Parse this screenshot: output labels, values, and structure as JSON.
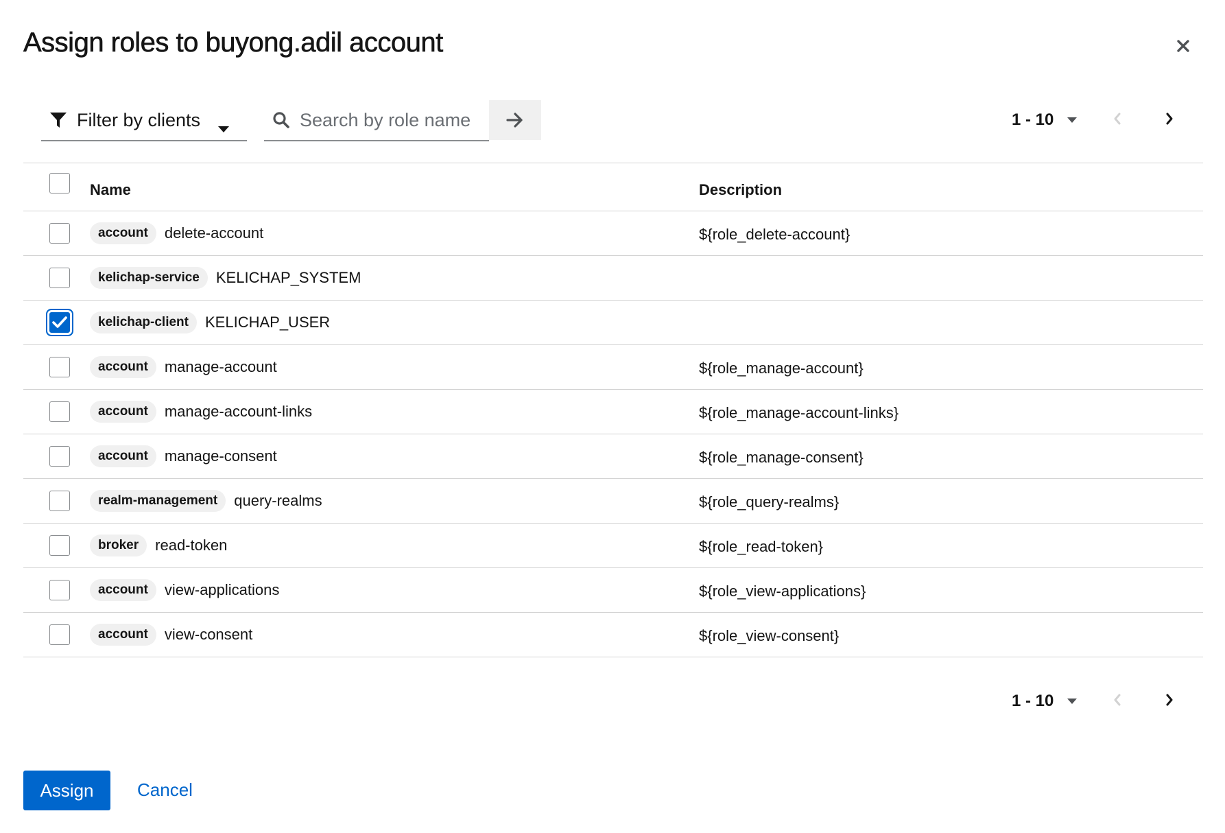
{
  "modal": {
    "title": "Assign roles to buyong.adil account"
  },
  "toolbar": {
    "filter_label": "Filter by clients",
    "search_placeholder": "Search by role name",
    "pagination_range": "1 - 10"
  },
  "table": {
    "headers": {
      "name": "Name",
      "description": "Description"
    },
    "rows": [
      {
        "client": "account",
        "role": "delete-account",
        "description": "${role_delete-account}",
        "checked": false
      },
      {
        "client": "kelichap-service",
        "role": "KELICHAP_SYSTEM",
        "description": "",
        "checked": false
      },
      {
        "client": "kelichap-client",
        "role": "KELICHAP_USER",
        "description": "",
        "checked": true
      },
      {
        "client": "account",
        "role": "manage-account",
        "description": "${role_manage-account}",
        "checked": false
      },
      {
        "client": "account",
        "role": "manage-account-links",
        "description": "${role_manage-account-links}",
        "checked": false
      },
      {
        "client": "account",
        "role": "manage-consent",
        "description": "${role_manage-consent}",
        "checked": false
      },
      {
        "client": "realm-management",
        "role": "query-realms",
        "description": "${role_query-realms}",
        "checked": false
      },
      {
        "client": "broker",
        "role": "read-token",
        "description": "${role_read-token}",
        "checked": false
      },
      {
        "client": "account",
        "role": "view-applications",
        "description": "${role_view-applications}",
        "checked": false
      },
      {
        "client": "account",
        "role": "view-consent",
        "description": "${role_view-consent}",
        "checked": false
      }
    ]
  },
  "footer_pagination": {
    "range": "1 - 10"
  },
  "actions": {
    "assign_label": "Assign",
    "cancel_label": "Cancel"
  },
  "colors": {
    "primary": "#0066cc",
    "badge_bg": "#f0f0f0",
    "border": "#d2d2d2"
  },
  "icons": [
    "close-icon",
    "filter-icon",
    "caret-down-icon",
    "search-icon",
    "arrow-right-icon",
    "chevron-left-icon",
    "chevron-right-icon",
    "checkmark-icon"
  ]
}
